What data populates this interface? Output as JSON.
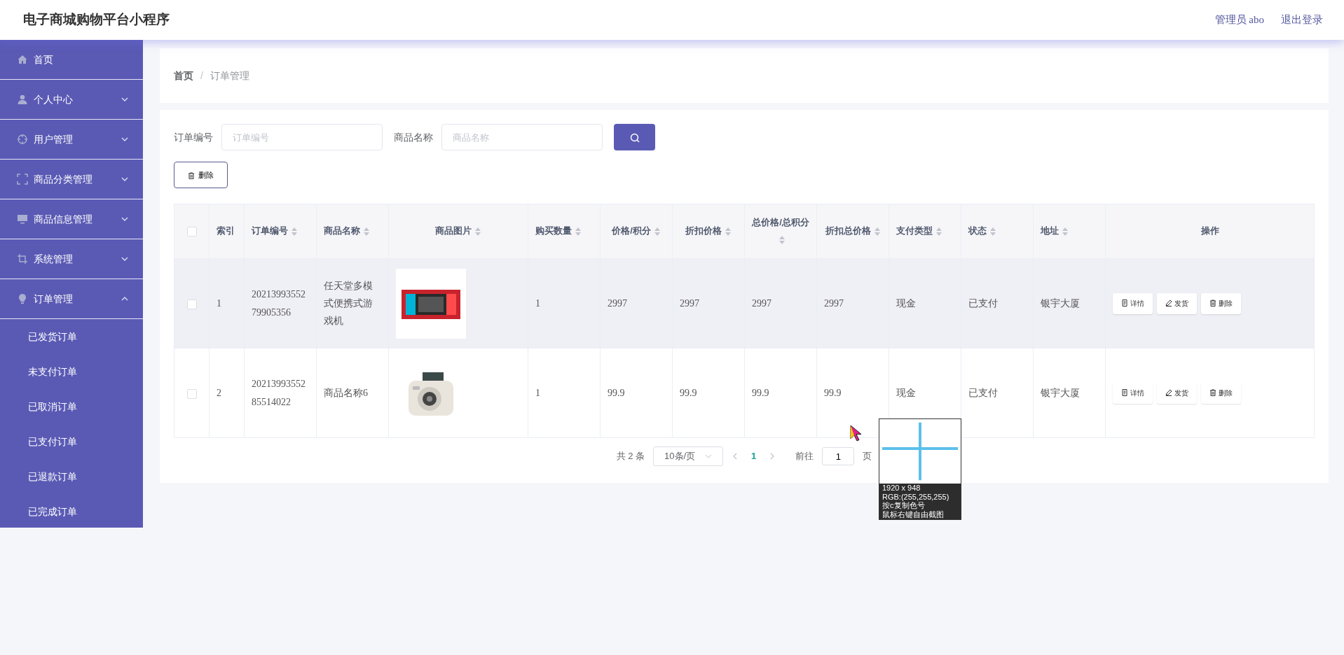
{
  "header": {
    "title": "电子商城购物平台小程序",
    "user": "管理员 abo",
    "logout": "退出登录"
  },
  "sidebar": {
    "items": [
      {
        "label": "首页"
      },
      {
        "label": "个人中心",
        "expanded": false
      },
      {
        "label": "用户管理",
        "expanded": false
      },
      {
        "label": "商品分类管理",
        "expanded": false
      },
      {
        "label": "商品信息管理",
        "expanded": false
      },
      {
        "label": "系统管理",
        "expanded": false
      },
      {
        "label": "订单管理",
        "expanded": true,
        "children": [
          {
            "label": "已发货订单"
          },
          {
            "label": "未支付订单"
          },
          {
            "label": "已取消订单"
          },
          {
            "label": "已支付订单"
          },
          {
            "label": "已退款订单"
          },
          {
            "label": "已完成订单"
          }
        ]
      }
    ]
  },
  "breadcrumb": {
    "separator": "/",
    "items": [
      "首页",
      "订单管理"
    ]
  },
  "search": {
    "fields": [
      {
        "label": "订单编号",
        "placeholder": "订单编号"
      },
      {
        "label": "商品名称",
        "placeholder": "商品名称"
      }
    ]
  },
  "toolbar": {
    "delete": "删除"
  },
  "table": {
    "columns": [
      {
        "kind": "checkbox",
        "checked": false
      },
      {
        "kind": "text",
        "label": "索引",
        "sortable": false
      },
      {
        "kind": "text",
        "label": "订单编号",
        "sortable": true
      },
      {
        "kind": "text",
        "label": "商品名称",
        "sortable": true
      },
      {
        "label": "商品图片",
        "sortable": true
      },
      {
        "kind": "text",
        "label": "购买数量",
        "sortable": true
      },
      {
        "kind": "text",
        "label": "价格/积分",
        "sortable": true
      },
      {
        "kind": "text",
        "label": "折扣价格",
        "sortable": true
      },
      {
        "kind": "text",
        "label": "总价格/总积分",
        "sortable": true
      },
      {
        "kind": "text",
        "label": "折扣总价格",
        "sortable": true
      },
      {
        "kind": "text",
        "label": "支付类型",
        "sortable": true
      },
      {
        "kind": "text",
        "label": "状态",
        "sortable": true
      },
      {
        "kind": "text",
        "label": "地址",
        "sortable": true
      },
      {
        "kind": "actions",
        "label": "操作",
        "sortable": false
      }
    ],
    "rows": [
      {
        "checked": false,
        "hover": true,
        "cells": [
          "",
          "1",
          "2021399355279905356",
          "任天堂多模式便携式游戏机",
          "",
          "1",
          "2997",
          "2997",
          "2997",
          "2997",
          "现金",
          "已支付",
          "银宇大厦",
          ""
        ],
        "image": {
          "kind": "picture"
        },
        "actions": [
          "详情",
          "发货",
          "删除"
        ]
      },
      {
        "checked": false,
        "hover": false,
        "cells": [
          "",
          "2",
          "2021399355285514022",
          "商品名称6",
          "",
          "1",
          "99.9",
          "99.9",
          "99.9",
          "99.9",
          "现金",
          "已支付",
          "银宇大厦",
          ""
        ],
        "image": {
          "kind": "picture"
        },
        "actions": [
          "详情",
          "发货",
          "删除"
        ]
      }
    ]
  },
  "pagination": {
    "total": "共 2 条",
    "page_size": "10条/页",
    "pages": [
      {
        "label": "1",
        "selected": true
      }
    ],
    "goto_label": "前往",
    "goto_value": "1",
    "goto_suffix": "页"
  },
  "color_picker_overlay": {
    "lines": [
      "1920 x 948",
      "RGB:(255,255,255)",
      "按c复制色号",
      "鼠标右键自由截图"
    ]
  }
}
